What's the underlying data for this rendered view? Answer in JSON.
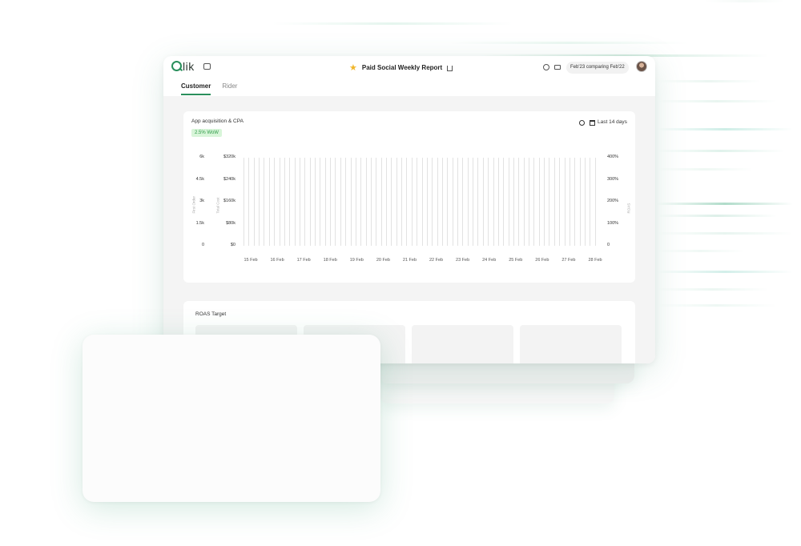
{
  "app": {
    "logo_first": "Q",
    "logo_rest": "lik",
    "report_title": "Paid Social Weekly Report",
    "compare_label": "Feb'23 comparing Feb'22"
  },
  "icons": [
    "chat-icon",
    "star-icon",
    "share-icon",
    "settings-icon",
    "server-icon",
    "avatar",
    "eye-icon",
    "calendar-icon"
  ],
  "colors": {
    "accent": "#2a8f5c",
    "star": "#f1b62a",
    "badge_bg": "#d8f5d9",
    "badge_text": "#2e9a48"
  },
  "tabs": [
    {
      "label": "Customer",
      "active": true
    },
    {
      "label": "Rider",
      "active": false
    }
  ],
  "acquisition_panel": {
    "title": "App acquisition & CPA",
    "badge": "2.5% WoW",
    "date_range": "Last 14 days",
    "axis_names": {
      "first": "First Order",
      "total": "Total Cost",
      "right": "ROAS"
    }
  },
  "roas_panel": {
    "title": "ROAS Target",
    "card_count": 4
  },
  "chart_data": {
    "type": "bar",
    "orders_axis_ticks": [
      "6k",
      "4.5k",
      "3k",
      "1.5k",
      "0"
    ],
    "cost_axis_ticks": [
      "$320k",
      "$240k",
      "$160k",
      "$80k",
      "$0"
    ],
    "roas_axis_ticks": [
      "400%",
      "300%",
      "200%",
      "100%",
      "0"
    ],
    "categories": [
      "15 Feb",
      "16 Feb",
      "17 Feb",
      "18 Feb",
      "19 Feb",
      "20 Feb",
      "21 Feb",
      "22 Feb",
      "23 Feb",
      "24 Feb",
      "25 Feb",
      "26 Feb",
      "27 Feb",
      "28 Feb"
    ],
    "ylim": [
      0,
      6000
    ],
    "bar_groups_per_day": 5,
    "grid": false
  }
}
